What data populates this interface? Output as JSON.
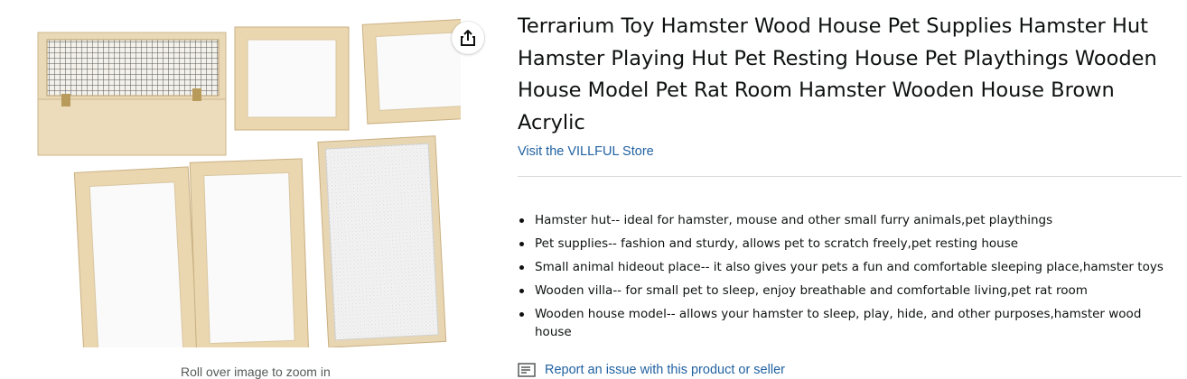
{
  "product": {
    "title": "Terrarium Toy Hamster Wood House Pet Supplies Hamster Hut Hamster Playing Hut Pet Resting House Pet Playthings Wooden House Model Pet Rat Room Hamster Wooden House Brown Acrylic",
    "store_link": "Visit the VILLFUL Store"
  },
  "image": {
    "zoom_hint": "Roll over image to zoom in",
    "share_icon": "share-icon"
  },
  "bullets": [
    "Hamster hut-- ideal for hamster, mouse and other small furry animals,pet playthings",
    "Pet supplies-- fashion and sturdy, allows pet to scratch freely,pet resting house",
    "Small animal hideout place-- it also gives your pets a fun and comfortable sleeping place,hamster toys",
    "Wooden villa-- for small pet to sleep, enjoy breathable and comfortable living,pet rat room",
    "Wooden house model-- allows your hamster to sleep, play, hide, and other purposes,hamster wood house"
  ],
  "report": {
    "label": "Report an issue with this product or seller",
    "icon": "report-icon"
  },
  "colors": {
    "link": "#2162a1",
    "text": "#0f1111",
    "wood": "#e9d7b3",
    "divider": "#d5d9d9"
  }
}
